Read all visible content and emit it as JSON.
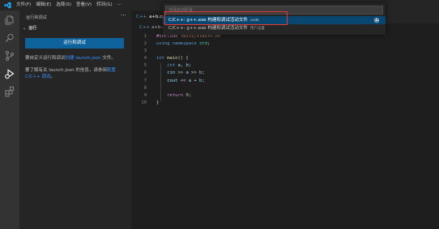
{
  "menu": [
    "文件(F)",
    "编辑(E)",
    "选择(S)",
    "查看(V)",
    "转到(G)",
    "···"
  ],
  "sidebar": {
    "title": "运行和调试",
    "more": "···",
    "section": "运行",
    "run_button": "运行和调试",
    "hint1_text": "要自定义运行和调试",
    "hint1_link": "创建 launch.json",
    "hint1_tail": " 文件。",
    "hint2_text": "要了解有关 launch.json 的信息，请参阅",
    "hint2_link": "配置 C/C++ 调试",
    "hint2_tail": "。"
  },
  "editor": {
    "tab_icon": "C++",
    "tab_label": "a+b.cpp",
    "breadcrumb_icon": "C++",
    "breadcrumb": "a+b.cpp",
    "lines": [
      {
        "n": "1",
        "t": [
          [
            "c-pre",
            "#include "
          ],
          [
            "c-inc",
            "<bits/stdc++.h>"
          ]
        ]
      },
      {
        "n": "2",
        "t": [
          [
            "c-kw",
            "using namespace "
          ],
          [
            "c-type",
            "std"
          ],
          [
            "c-txt",
            ";"
          ]
        ]
      },
      {
        "n": "3",
        "t": []
      },
      {
        "n": "4",
        "t": [
          [
            "c-kw",
            "int "
          ],
          [
            "c-fn",
            "main"
          ],
          [
            "c-txt",
            "() {"
          ]
        ]
      },
      {
        "n": "5",
        "t": [
          [
            "c-txt",
            "    "
          ],
          [
            "c-kw",
            "int "
          ],
          [
            "c-var",
            "a"
          ],
          [
            "c-txt",
            ", "
          ],
          [
            "c-var",
            "b"
          ],
          [
            "c-txt",
            ";"
          ]
        ]
      },
      {
        "n": "6",
        "t": [
          [
            "c-txt",
            "    "
          ],
          [
            "c-var",
            "cin"
          ],
          [
            "c-txt",
            " >> "
          ],
          [
            "c-var",
            "a"
          ],
          [
            "c-txt",
            " >> "
          ],
          [
            "c-var",
            "b"
          ],
          [
            "c-txt",
            ";"
          ]
        ]
      },
      {
        "n": "7",
        "t": [
          [
            "c-txt",
            "    "
          ],
          [
            "c-var",
            "cout"
          ],
          [
            "c-txt",
            " << "
          ],
          [
            "c-var",
            "a"
          ],
          [
            "c-txt",
            " + "
          ],
          [
            "c-var",
            "b"
          ],
          [
            "c-txt",
            ";"
          ]
        ]
      },
      {
        "n": "8",
        "t": []
      },
      {
        "n": "9",
        "t": [
          [
            "c-txt",
            "    "
          ],
          [
            "c-ctl",
            "return "
          ],
          [
            "c-num",
            "0"
          ],
          [
            "c-txt",
            ";"
          ]
        ]
      },
      {
        "n": "10",
        "t": [
          [
            "c-txt",
            "}"
          ]
        ]
      }
    ]
  },
  "quickpick": {
    "placeholder": "选择启动配置",
    "items": [
      {
        "label": "C/C++: g++.exe 构建和调试活动文件",
        "desc": "code"
      },
      {
        "label": "C/C++: g++.exe 构建和调试活动文件",
        "desc": "用户设置"
      }
    ]
  },
  "colors": {
    "accent": "#0e639c",
    "selection": "#094771",
    "highlight_box": "#e53935",
    "link": "#3794ff"
  }
}
